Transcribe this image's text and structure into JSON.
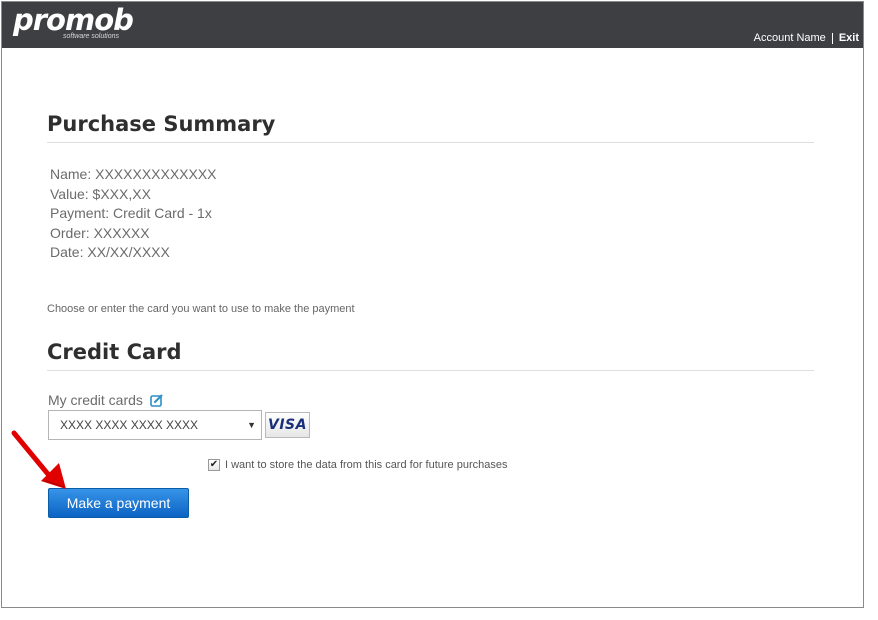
{
  "header": {
    "logo_text": "promob",
    "logo_tagline": "software solutions",
    "account_name": "Account Name",
    "exit_label": "Exit"
  },
  "summary": {
    "title": "Purchase Summary",
    "lines": [
      "Name: XXXXXXXXXXXXX",
      "Value: $XXX,XX",
      "Payment: Credit Card - 1x",
      "Order: XXXXXX",
      "Date: XX/XX/XXXX"
    ]
  },
  "payment": {
    "hint": "Choose or enter the card you want to use to make the payment",
    "title": "Credit Card",
    "my_cards_label": "My credit cards",
    "selected_card": "XXXX XXXX XXXX XXXX",
    "card_brand": "VISA",
    "store_label": "I want to store the data from this card for future purchases",
    "store_checked": true,
    "submit_label": "Make a payment"
  },
  "colors": {
    "header_bg": "#3e3f42",
    "button_blue": "#0b63c4",
    "annotation_arrow": "#e00000"
  },
  "icons": {
    "edit": "edit-icon",
    "dropdown": "caret-down-icon",
    "annotation": "red-arrow-icon"
  }
}
